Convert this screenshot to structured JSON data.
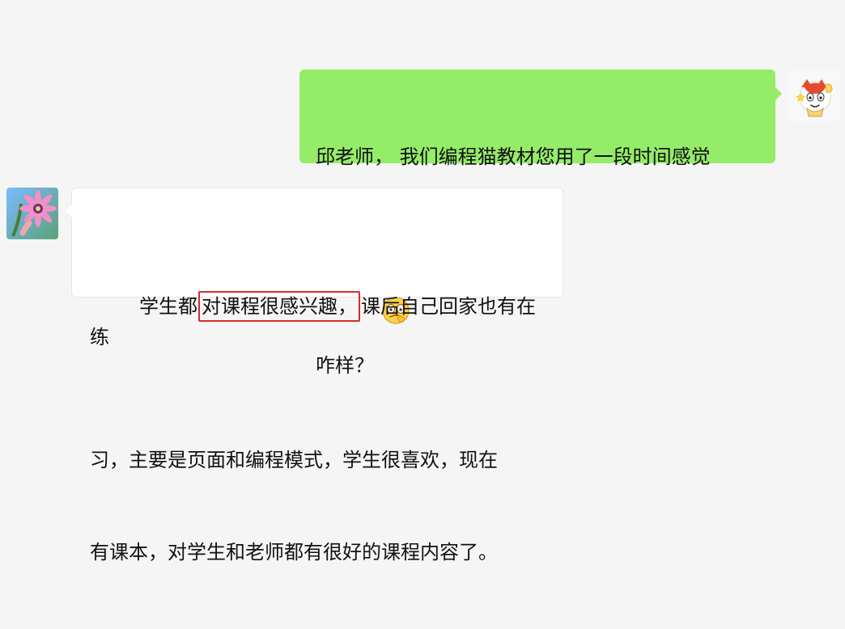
{
  "chat": {
    "messages": [
      {
        "side": "right",
        "avatar_icon": "cartoon-cat-avatar-icon",
        "line1": "邱老师， 我们编程猫教材您用了一段时间感觉",
        "line2": "咋样？",
        "emoji_icon": "thinking-face-emoji-icon"
      },
      {
        "side": "left",
        "avatar_icon": "flower-avatar-icon",
        "line1_prefix": "学生都",
        "line1_highlight": "对课程很感兴趣，",
        "line1_suffix": "课后自己回家也有在练",
        "line2": "习，主要是页面和编程模式，学生很喜欢，现在",
        "line3": "有课本，对学生和老师都有很好的课程内容了。",
        "highlight_color": "#d62a2a"
      }
    ],
    "colors": {
      "background": "#f5f5f5",
      "sent_bubble": "#95ec69",
      "received_bubble": "#ffffff"
    }
  }
}
